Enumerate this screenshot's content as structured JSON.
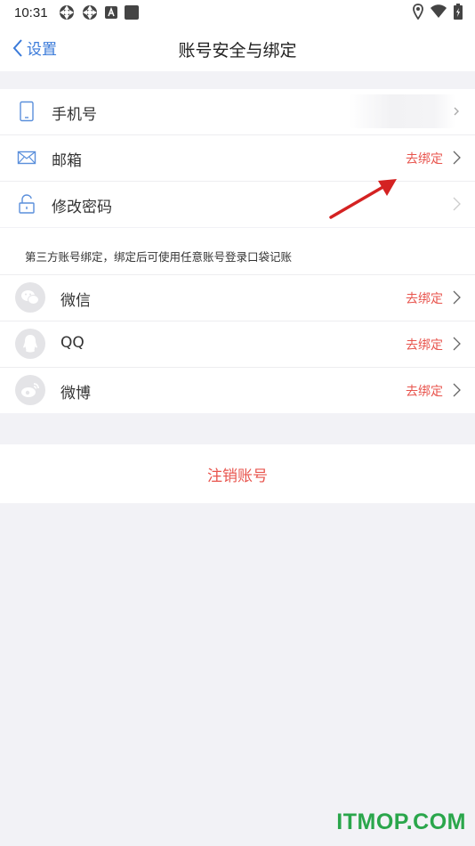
{
  "status_bar": {
    "time": "10:31"
  },
  "nav": {
    "back_label": "设置",
    "title": "账号安全与绑定"
  },
  "account_rows": [
    {
      "label": "手机号",
      "action": ""
    },
    {
      "label": "邮箱",
      "action": "去绑定"
    },
    {
      "label": "修改密码",
      "action": ""
    }
  ],
  "third_party_note": "第三方账号绑定，绑定后可使用任意账号登录口袋记账",
  "social_rows": [
    {
      "label": "微信",
      "action": "去绑定"
    },
    {
      "label": "QQ",
      "action": "去绑定"
    },
    {
      "label": "微博",
      "action": "去绑定"
    }
  ],
  "logout_label": "注销账号",
  "watermark": "ITMOP.COM",
  "colors": {
    "accent_blue": "#3a7ad9",
    "action_red": "#e8554e",
    "background": "#f2f2f6",
    "watermark_green": "#2aa64b"
  }
}
